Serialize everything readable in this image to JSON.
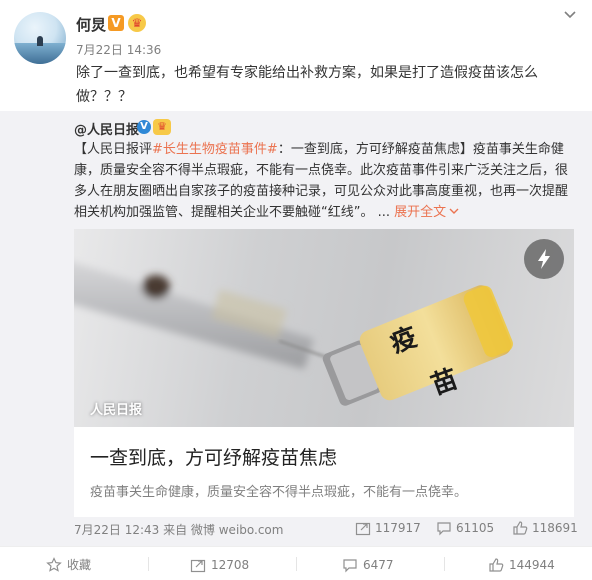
{
  "post": {
    "author": "何炅",
    "v_badge": "V",
    "member_badge": "♛",
    "time": "7月22日 14:36",
    "text": "除了一查到底，也希望有专家能给出补救方案，如果是打了造假疫苗该怎么做？？？"
  },
  "repost": {
    "author": "@人民日报",
    "v_badge": "V",
    "member_badge": "♛",
    "text_prefix": "【人民日报评",
    "hashtag": "#长生生物疫苗事件#",
    "text_body": "：一查到底，方可纾解疫苗焦虑】疫苗事关生命健康，质量安全容不得半点瑕疵，不能有一点侥幸。此次疫苗事件引来广泛关注之后，很多人在朋友圈晒出自家孩子的疫苗接种记录，可见公众对此事高度重视，也再一次提醒相关机构加强监管、提醒相关企业不要触碰“红线”。",
    "ellipsis": " ... ",
    "expand_label": "展开全文",
    "card": {
      "image_label": "人民日报",
      "vial_text_1": "疫",
      "vial_text_2": "苗",
      "title": "一查到底，方可纾解疫苗焦虑",
      "description": "疫苗事关生命健康，质量安全容不得半点瑕疵，不能有一点侥幸。"
    },
    "meta": "7月22日 12:43 来自 微博 weibo.com",
    "stats": {
      "reposts": "117917",
      "comments": "61105",
      "likes": "118691"
    }
  },
  "actions": {
    "favorite": "收藏",
    "repost": "12708",
    "comment": "6477",
    "like": "144944"
  },
  "colors": {
    "accent": "#eb7350",
    "muted": "#808080",
    "repost_bg": "#f2f2f5"
  }
}
